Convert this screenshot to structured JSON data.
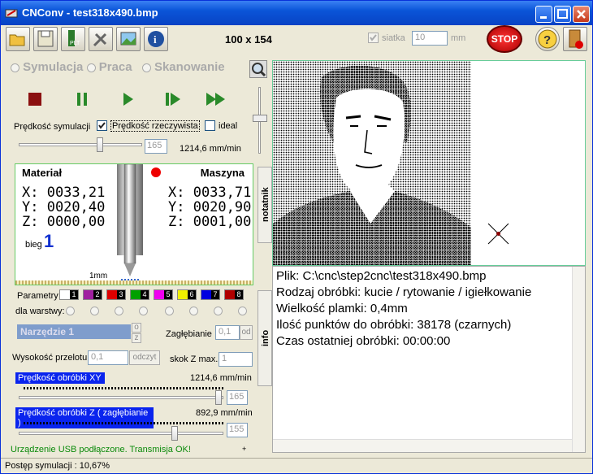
{
  "window": {
    "title": "CNConv - test318x490.bmp"
  },
  "toolbar": {
    "dimensions": "100 x 154",
    "grid_label": "siatka",
    "grid_value": "10",
    "grid_unit": "mm",
    "stop_label": "STOP",
    "buttons": [
      "open",
      "save",
      "plt",
      "tools",
      "image",
      "info",
      "help",
      "exit"
    ]
  },
  "modes": {
    "sim": "Symulacja",
    "work": "Praca",
    "scan": "Skanowanie"
  },
  "sim": {
    "speed_label": "Prędkość symulacji",
    "realtime_label": "Prędkość rzeczywista",
    "ideal_label": "ideal",
    "speed_value": "165",
    "speed_readout": "1214,6 mm/min"
  },
  "position": {
    "material_label": "Materiał",
    "machine_label": "Maszyna",
    "mx": "X: 0033,21",
    "my": "Y: 0020,40",
    "mz": "Z: 0000,00",
    "hx": "X: 0033,71",
    "hy": "Y: 0020,90",
    "hz": "Z: 0001,00",
    "gear_label": "bieg",
    "gear_value": "1",
    "scale": "1mm"
  },
  "params": {
    "label": "Parametry",
    "layers_label": "dla warstwy:",
    "tool": "Narzędzie 1",
    "depth_label": "Zagłębianie",
    "depth_value": "0,1",
    "depth_btn": "od",
    "safe_label": "Wysokość przelotu",
    "safe_value": "0,1",
    "safe_btn": "odczyt",
    "zstep_label": "skok Z max.",
    "zstep_value": "1",
    "xy_label": "Prędkość obróbki XY",
    "xy_readout": "1214,6 mm/min",
    "xy_value": "165",
    "z_label": "Prędkość obróbki Z  ( zagłębianie )",
    "z_readout": "892,9 mm/min",
    "z_value": "155",
    "swatches": [
      {
        "n": "1",
        "c": "#ffffff"
      },
      {
        "n": "2",
        "c": "#a020a0"
      },
      {
        "n": "3",
        "c": "#e00000"
      },
      {
        "n": "4",
        "c": "#00a000"
      },
      {
        "n": "5",
        "c": "#f000f0"
      },
      {
        "n": "6",
        "c": "#f0f000"
      },
      {
        "n": "7",
        "c": "#0000e0"
      },
      {
        "n": "8",
        "c": "#b00000"
      }
    ]
  },
  "tabs": {
    "notes": "notatnik",
    "info": "info"
  },
  "info": {
    "file": "Plik: C:\\cnc\\step2cnc\\test318x490.bmp",
    "type": "Rodzaj obróbki: kucie / rytowanie / igiełkowanie",
    "spot": "Wielkość plamki: 0,4mm",
    "points": "Ilość punktów do obróbki: 38178 (czarnych)",
    "time": "Czas ostatniej obróbki: 00:00:00"
  },
  "status": {
    "usb": "Urządzenie USB podłączone. Transmisja OK!",
    "progress": "Postęp symulacji : 10,67%"
  }
}
